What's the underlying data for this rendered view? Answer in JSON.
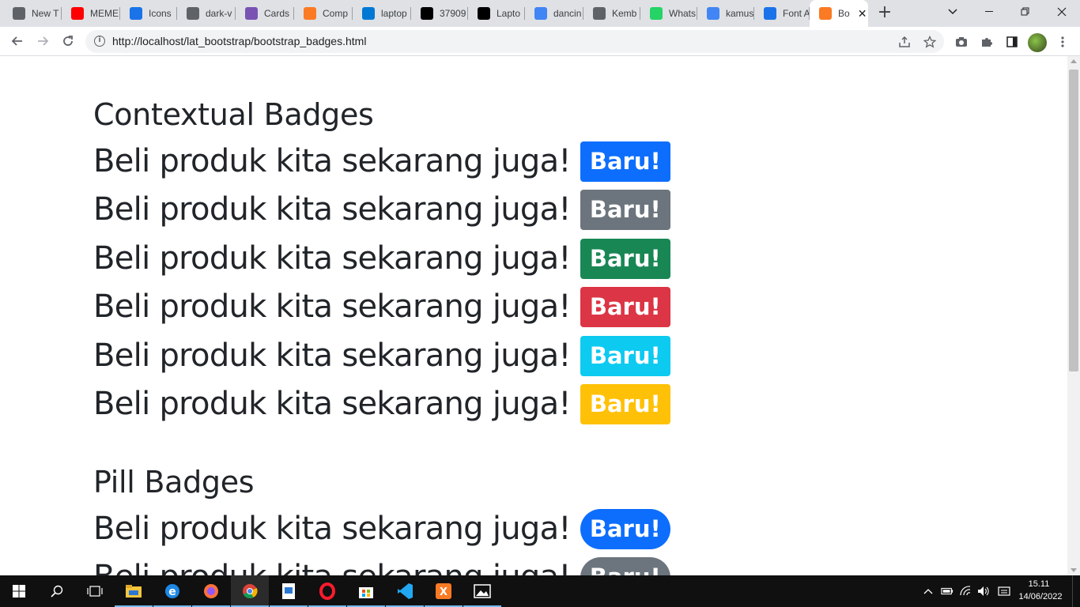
{
  "browser": {
    "tabs": [
      {
        "label": "New T",
        "icon": "chrome-icon",
        "color": "#5f6368"
      },
      {
        "label": "MEME",
        "icon": "youtube-icon",
        "color": "#ff0000"
      },
      {
        "label": "Icons",
        "icon": "flag-icon",
        "color": "#1a73e8"
      },
      {
        "label": "dark-v",
        "icon": "globe-icon",
        "color": "#5f6368"
      },
      {
        "label": "Cards",
        "icon": "bootstrap-icon",
        "color": "#7952b3"
      },
      {
        "label": "Comp",
        "icon": "xampp-icon",
        "color": "#fb7a24"
      },
      {
        "label": "laptop",
        "icon": "bing-icon",
        "color": "#0078d4"
      },
      {
        "label": "37909",
        "icon": "site-icon",
        "color": "#000000"
      },
      {
        "label": "Lapto",
        "icon": "fm-icon",
        "color": "#000000"
      },
      {
        "label": "dancin",
        "icon": "google-icon",
        "color": "#4285f4"
      },
      {
        "label": "Kemb",
        "icon": "globe-icon",
        "color": "#5f6368"
      },
      {
        "label": "Whats",
        "icon": "whatsapp-icon",
        "color": "#25d366"
      },
      {
        "label": "kamus",
        "icon": "google-icon",
        "color": "#4285f4"
      },
      {
        "label": "Font A",
        "icon": "flag-icon",
        "color": "#1a73e8"
      },
      {
        "label": "Bo",
        "icon": "xampp-icon",
        "color": "#fb7a24",
        "active": true
      }
    ],
    "url": "http://localhost/lat_bootstrap/bootstrap_badges.html"
  },
  "page": {
    "sections": [
      {
        "heading": "Contextual Badges",
        "rows": [
          {
            "text": "Beli produk kita sekarang juga!",
            "badge": "Baru!",
            "color": "#0d6efd",
            "variant": "primary"
          },
          {
            "text": "Beli produk kita sekarang juga!",
            "badge": "Baru!",
            "color": "#6c757d",
            "variant": "secondary"
          },
          {
            "text": "Beli produk kita sekarang juga!",
            "badge": "Baru!",
            "color": "#198754",
            "variant": "success"
          },
          {
            "text": "Beli produk kita sekarang juga!",
            "badge": "Baru!",
            "color": "#dc3545",
            "variant": "danger"
          },
          {
            "text": "Beli produk kita sekarang juga!",
            "badge": "Baru!",
            "color": "#0dcaf0",
            "variant": "info"
          },
          {
            "text": "Beli produk kita sekarang juga!",
            "badge": "Baru!",
            "color": "#ffc107",
            "variant": "warning"
          }
        ]
      },
      {
        "heading": "Pill Badges",
        "rows": [
          {
            "text": "Beli produk kita sekarang juga!",
            "badge": "Baru!",
            "color": "#0d6efd",
            "variant": "primary"
          },
          {
            "text": "Beli produk kita sekarang juga!",
            "badge": "Baru!",
            "color": "#6c757d",
            "variant": "secondary"
          }
        ]
      }
    ]
  },
  "taskbar": {
    "apps": [
      {
        "name": "file-explorer-icon"
      },
      {
        "name": "edge-icon"
      },
      {
        "name": "firefox-icon"
      },
      {
        "name": "chrome-icon",
        "active": true
      },
      {
        "name": "notepad-icon"
      },
      {
        "name": "opera-icon"
      },
      {
        "name": "store-icon"
      },
      {
        "name": "vscode-icon"
      },
      {
        "name": "xampp-icon"
      },
      {
        "name": "photos-icon"
      }
    ],
    "time": "15.11",
    "date": "14/06/2022"
  }
}
